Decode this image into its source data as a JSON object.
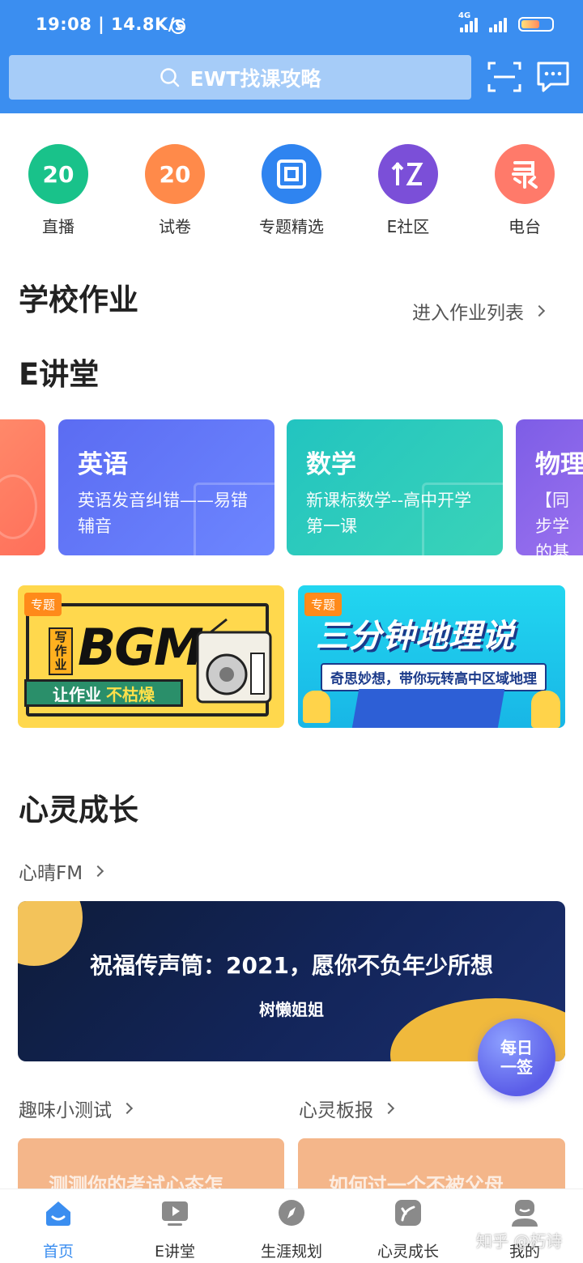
{
  "status_bar": {
    "time": "19:08 | 14.8K/s",
    "network": "4G"
  },
  "header": {
    "search_placeholder": "EWT找课攻略"
  },
  "quick_nav": [
    {
      "label": "直播",
      "icon": "20",
      "color": "#19c28a"
    },
    {
      "label": "试卷",
      "icon": "20",
      "color": "#ff8a4a"
    },
    {
      "label": "专题精选",
      "icon": "square-icon",
      "color": "#2f84f0"
    },
    {
      "label": "E社区",
      "icon": "community-icon",
      "color": "#7b4fd8"
    },
    {
      "label": "电台",
      "icon": "radio-icon",
      "color": "#ff7a6a"
    }
  ],
  "homework": {
    "title": "学校作业",
    "link": "进入作业列表"
  },
  "lecture": {
    "title": "E讲堂",
    "courses": [
      {
        "title": "英语",
        "desc": "英语发音纠错——易错辅音"
      },
      {
        "title": "数学",
        "desc": "新课标数学--高中开学第一课"
      },
      {
        "title": "物理",
        "desc": "【同步学的基"
      }
    ]
  },
  "banners": [
    {
      "tag": "专题",
      "text_small": "写作业",
      "text_big": "BGM",
      "text_bottom_a": "让作业",
      "text_bottom_b": "不枯燥"
    },
    {
      "tag": "专题",
      "text_big": "三分钟地理说",
      "text_sub": "奇思妙想，带你玩转高中区域地理"
    }
  ],
  "growth": {
    "title": "心灵成长",
    "fm_link": "心晴FM",
    "fm_banner": {
      "title": "祝福传声筒：2021，愿你不负年少所想",
      "author": "树懒姐姐"
    },
    "quiz_link": "趣味小测试",
    "board_link": "心灵板报",
    "quiz_card": "测测你的考试心态怎",
    "board_card": "如何过一个不被父母"
  },
  "float_button": {
    "line1": "每日",
    "line2": "一签"
  },
  "tabbar": [
    {
      "label": "首页",
      "active": true
    },
    {
      "label": "E讲堂",
      "active": false
    },
    {
      "label": "生涯规划",
      "active": false
    },
    {
      "label": "心灵成长",
      "active": false
    },
    {
      "label": "我的",
      "active": false
    }
  ],
  "watermark": "知乎 @朽诗"
}
